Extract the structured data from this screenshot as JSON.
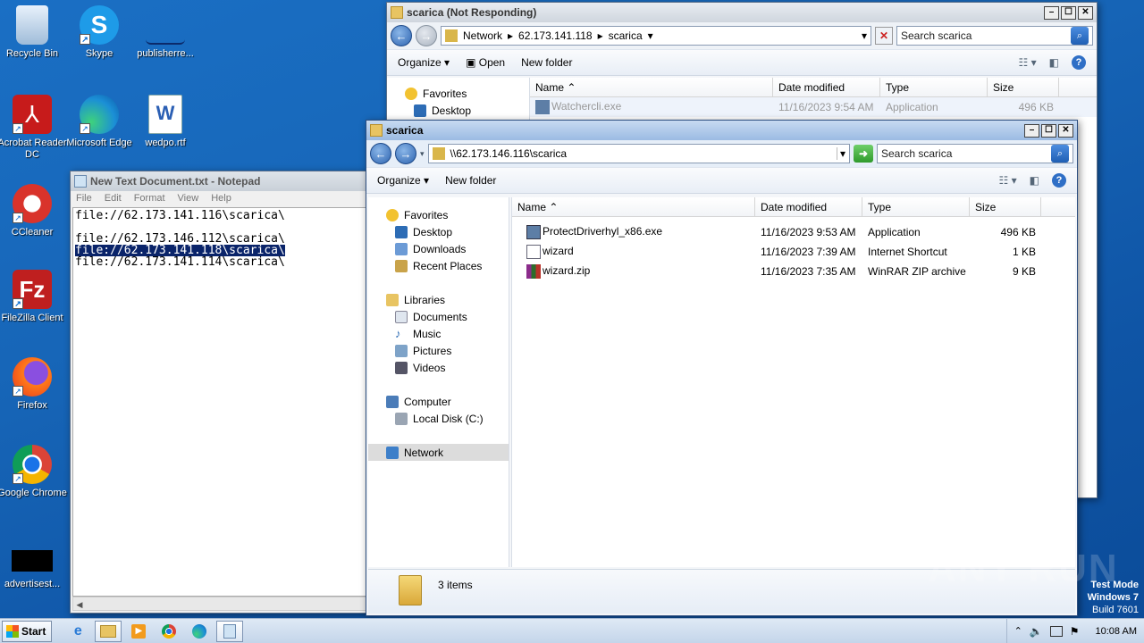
{
  "desktop": {
    "icons": [
      {
        "label": "Recycle Bin"
      },
      {
        "label": "Skype"
      },
      {
        "label": "publisherre..."
      },
      {
        "label": "Acrobat Reader DC"
      },
      {
        "label": "Microsoft Edge"
      },
      {
        "label": "wedpo.rtf"
      },
      {
        "label": "CCleaner"
      },
      {
        "label": "FileZilla Client"
      },
      {
        "label": "Firefox"
      },
      {
        "label": "Google Chrome"
      },
      {
        "label": "advertisest..."
      }
    ],
    "watermark": {
      "brand": "ANY RUN",
      "line1": "Test Mode",
      "line2": "Windows 7",
      "line3": "Build 7601"
    }
  },
  "notepad": {
    "title": "New Text Document.txt - Notepad",
    "menu": [
      "File",
      "Edit",
      "Format",
      "View",
      "Help"
    ],
    "lines": [
      "file://62.173.141.116\\scarica\\",
      "",
      "file://62.173.146.112\\scarica\\",
      "file://62.173.141.118\\scarica\\",
      "file://62.173.141.114\\scarica\\"
    ]
  },
  "explorer_back": {
    "title": "scarica (Not Responding)",
    "breadcrumb": [
      "Network",
      "62.173.141.118",
      "scarica"
    ],
    "search_placeholder": "Search scarica",
    "commands": [
      "Organize",
      "Open",
      "New folder"
    ],
    "nav": {
      "favorites": "Favorites",
      "desktop": "Desktop"
    },
    "columns": [
      "Name",
      "Date modified",
      "Type",
      "Size"
    ],
    "row": {
      "name": "Watchercli.exe",
      "date": "11/16/2023 9:54 AM",
      "type": "Application",
      "size": "496 KB"
    }
  },
  "explorer_front": {
    "title": "scarica",
    "address": "\\\\62.173.146.116\\scarica",
    "search_placeholder": "Search scarica",
    "commands": [
      "Organize",
      "New folder"
    ],
    "nav": {
      "favorites": "Favorites",
      "fav_items": [
        "Desktop",
        "Downloads",
        "Recent Places"
      ],
      "libraries": "Libraries",
      "lib_items": [
        "Documents",
        "Music",
        "Pictures",
        "Videos"
      ],
      "computer": "Computer",
      "comp_items": [
        "Local Disk (C:)"
      ],
      "network": "Network"
    },
    "columns": [
      "Name",
      "Date modified",
      "Type",
      "Size"
    ],
    "files": [
      {
        "name": "ProtectDriverhyl_x86.exe",
        "date": "11/16/2023 9:53 AM",
        "type": "Application",
        "size": "496 KB"
      },
      {
        "name": "wizard",
        "date": "11/16/2023 7:39 AM",
        "type": "Internet Shortcut",
        "size": "1 KB"
      },
      {
        "name": "wizard.zip",
        "date": "11/16/2023 7:35 AM",
        "type": "WinRAR ZIP archive",
        "size": "9 KB"
      }
    ],
    "status": "3 items"
  },
  "taskbar": {
    "start": "Start",
    "clock": "10:08 AM"
  }
}
